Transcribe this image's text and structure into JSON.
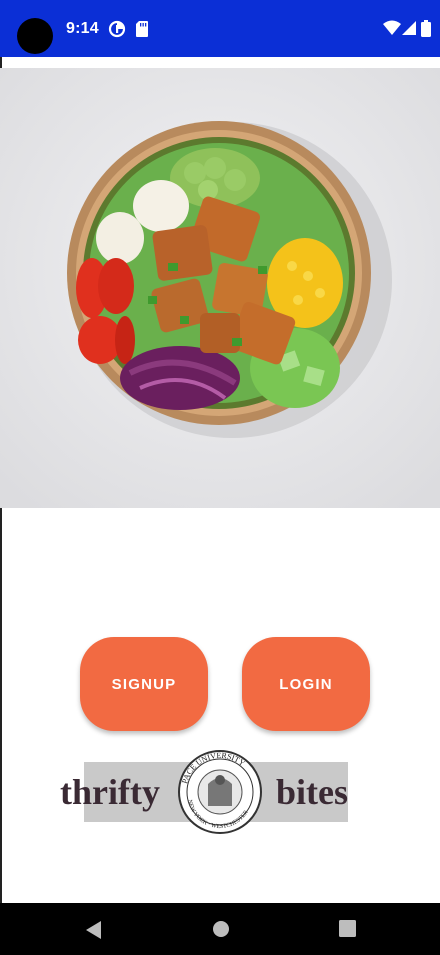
{
  "status_bar": {
    "time": "9:14",
    "icons": [
      "camera-cutout-icon",
      "data-saver-icon",
      "sd-card-icon",
      "wifi-icon",
      "signal-icon",
      "battery-icon"
    ],
    "background_color": "#0b2fd6"
  },
  "hero": {
    "image": "salad-bowl-photo"
  },
  "buttons": {
    "signup_label": "SIGNUP",
    "login_label": "LOGIN",
    "color": "#f26a42"
  },
  "logo": {
    "left_word": "thrifty",
    "right_word": "bites",
    "seal_text": "PACE UNIVERSITY · NEW YORK · WESTCHESTER"
  },
  "nav_bar": {
    "icons": [
      "back-icon",
      "home-icon",
      "recents-icon"
    ]
  }
}
